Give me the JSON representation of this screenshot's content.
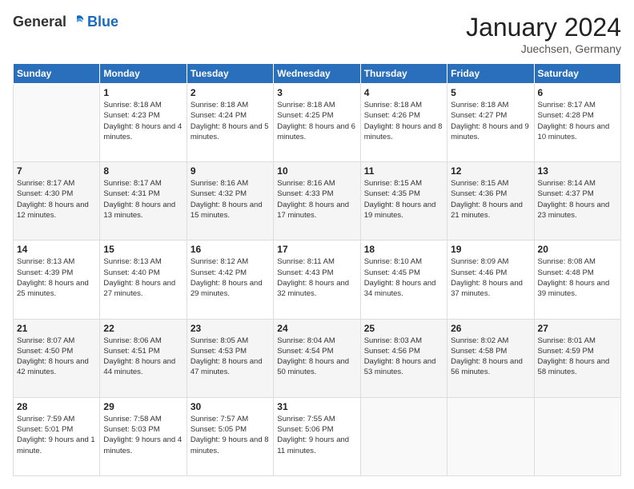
{
  "header": {
    "logo_general": "General",
    "logo_blue": "Blue",
    "month_title": "January 2024",
    "location": "Juechsen, Germany"
  },
  "weekdays": [
    "Sunday",
    "Monday",
    "Tuesday",
    "Wednesday",
    "Thursday",
    "Friday",
    "Saturday"
  ],
  "weeks": [
    [
      {
        "day": "",
        "sunrise": "",
        "sunset": "",
        "daylight": ""
      },
      {
        "day": "1",
        "sunrise": "Sunrise: 8:18 AM",
        "sunset": "Sunset: 4:23 PM",
        "daylight": "Daylight: 8 hours and 4 minutes."
      },
      {
        "day": "2",
        "sunrise": "Sunrise: 8:18 AM",
        "sunset": "Sunset: 4:24 PM",
        "daylight": "Daylight: 8 hours and 5 minutes."
      },
      {
        "day": "3",
        "sunrise": "Sunrise: 8:18 AM",
        "sunset": "Sunset: 4:25 PM",
        "daylight": "Daylight: 8 hours and 6 minutes."
      },
      {
        "day": "4",
        "sunrise": "Sunrise: 8:18 AM",
        "sunset": "Sunset: 4:26 PM",
        "daylight": "Daylight: 8 hours and 8 minutes."
      },
      {
        "day": "5",
        "sunrise": "Sunrise: 8:18 AM",
        "sunset": "Sunset: 4:27 PM",
        "daylight": "Daylight: 8 hours and 9 minutes."
      },
      {
        "day": "6",
        "sunrise": "Sunrise: 8:17 AM",
        "sunset": "Sunset: 4:28 PM",
        "daylight": "Daylight: 8 hours and 10 minutes."
      }
    ],
    [
      {
        "day": "7",
        "sunrise": "Sunrise: 8:17 AM",
        "sunset": "Sunset: 4:30 PM",
        "daylight": "Daylight: 8 hours and 12 minutes."
      },
      {
        "day": "8",
        "sunrise": "Sunrise: 8:17 AM",
        "sunset": "Sunset: 4:31 PM",
        "daylight": "Daylight: 8 hours and 13 minutes."
      },
      {
        "day": "9",
        "sunrise": "Sunrise: 8:16 AM",
        "sunset": "Sunset: 4:32 PM",
        "daylight": "Daylight: 8 hours and 15 minutes."
      },
      {
        "day": "10",
        "sunrise": "Sunrise: 8:16 AM",
        "sunset": "Sunset: 4:33 PM",
        "daylight": "Daylight: 8 hours and 17 minutes."
      },
      {
        "day": "11",
        "sunrise": "Sunrise: 8:15 AM",
        "sunset": "Sunset: 4:35 PM",
        "daylight": "Daylight: 8 hours and 19 minutes."
      },
      {
        "day": "12",
        "sunrise": "Sunrise: 8:15 AM",
        "sunset": "Sunset: 4:36 PM",
        "daylight": "Daylight: 8 hours and 21 minutes."
      },
      {
        "day": "13",
        "sunrise": "Sunrise: 8:14 AM",
        "sunset": "Sunset: 4:37 PM",
        "daylight": "Daylight: 8 hours and 23 minutes."
      }
    ],
    [
      {
        "day": "14",
        "sunrise": "Sunrise: 8:13 AM",
        "sunset": "Sunset: 4:39 PM",
        "daylight": "Daylight: 8 hours and 25 minutes."
      },
      {
        "day": "15",
        "sunrise": "Sunrise: 8:13 AM",
        "sunset": "Sunset: 4:40 PM",
        "daylight": "Daylight: 8 hours and 27 minutes."
      },
      {
        "day": "16",
        "sunrise": "Sunrise: 8:12 AM",
        "sunset": "Sunset: 4:42 PM",
        "daylight": "Daylight: 8 hours and 29 minutes."
      },
      {
        "day": "17",
        "sunrise": "Sunrise: 8:11 AM",
        "sunset": "Sunset: 4:43 PM",
        "daylight": "Daylight: 8 hours and 32 minutes."
      },
      {
        "day": "18",
        "sunrise": "Sunrise: 8:10 AM",
        "sunset": "Sunset: 4:45 PM",
        "daylight": "Daylight: 8 hours and 34 minutes."
      },
      {
        "day": "19",
        "sunrise": "Sunrise: 8:09 AM",
        "sunset": "Sunset: 4:46 PM",
        "daylight": "Daylight: 8 hours and 37 minutes."
      },
      {
        "day": "20",
        "sunrise": "Sunrise: 8:08 AM",
        "sunset": "Sunset: 4:48 PM",
        "daylight": "Daylight: 8 hours and 39 minutes."
      }
    ],
    [
      {
        "day": "21",
        "sunrise": "Sunrise: 8:07 AM",
        "sunset": "Sunset: 4:50 PM",
        "daylight": "Daylight: 8 hours and 42 minutes."
      },
      {
        "day": "22",
        "sunrise": "Sunrise: 8:06 AM",
        "sunset": "Sunset: 4:51 PM",
        "daylight": "Daylight: 8 hours and 44 minutes."
      },
      {
        "day": "23",
        "sunrise": "Sunrise: 8:05 AM",
        "sunset": "Sunset: 4:53 PM",
        "daylight": "Daylight: 8 hours and 47 minutes."
      },
      {
        "day": "24",
        "sunrise": "Sunrise: 8:04 AM",
        "sunset": "Sunset: 4:54 PM",
        "daylight": "Daylight: 8 hours and 50 minutes."
      },
      {
        "day": "25",
        "sunrise": "Sunrise: 8:03 AM",
        "sunset": "Sunset: 4:56 PM",
        "daylight": "Daylight: 8 hours and 53 minutes."
      },
      {
        "day": "26",
        "sunrise": "Sunrise: 8:02 AM",
        "sunset": "Sunset: 4:58 PM",
        "daylight": "Daylight: 8 hours and 56 minutes."
      },
      {
        "day": "27",
        "sunrise": "Sunrise: 8:01 AM",
        "sunset": "Sunset: 4:59 PM",
        "daylight": "Daylight: 8 hours and 58 minutes."
      }
    ],
    [
      {
        "day": "28",
        "sunrise": "Sunrise: 7:59 AM",
        "sunset": "Sunset: 5:01 PM",
        "daylight": "Daylight: 9 hours and 1 minute."
      },
      {
        "day": "29",
        "sunrise": "Sunrise: 7:58 AM",
        "sunset": "Sunset: 5:03 PM",
        "daylight": "Daylight: 9 hours and 4 minutes."
      },
      {
        "day": "30",
        "sunrise": "Sunrise: 7:57 AM",
        "sunset": "Sunset: 5:05 PM",
        "daylight": "Daylight: 9 hours and 8 minutes."
      },
      {
        "day": "31",
        "sunrise": "Sunrise: 7:55 AM",
        "sunset": "Sunset: 5:06 PM",
        "daylight": "Daylight: 9 hours and 11 minutes."
      },
      {
        "day": "",
        "sunrise": "",
        "sunset": "",
        "daylight": ""
      },
      {
        "day": "",
        "sunrise": "",
        "sunset": "",
        "daylight": ""
      },
      {
        "day": "",
        "sunrise": "",
        "sunset": "",
        "daylight": ""
      }
    ]
  ]
}
